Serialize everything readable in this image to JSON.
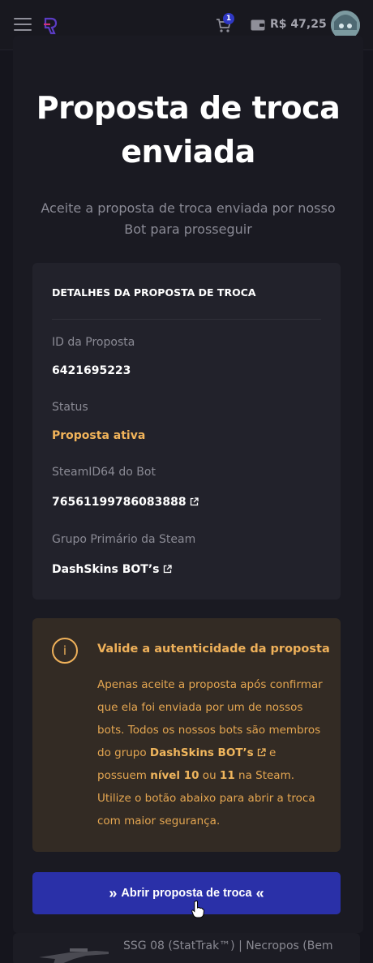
{
  "header": {
    "cart_count": "1",
    "balance": "R$ 47,25",
    "icons": {
      "menu": "hamburger-icon",
      "logo": "dashskins-logo",
      "cart": "cart-icon",
      "wallet": "wallet-icon"
    }
  },
  "modal": {
    "title": "Proposta de troca enviada",
    "subtitle": "Aceite a proposta de troca enviada por nosso Bot para prosseguir",
    "details": {
      "heading": "DETALHES DA PROPOSTA DE TROCA",
      "fields": [
        {
          "label": "ID da Proposta",
          "value": "6421695223"
        },
        {
          "label": "Status",
          "value": "Proposta ativa"
        },
        {
          "label": "SteamID64 do Bot",
          "value": "76561199786083888"
        },
        {
          "label": "Grupo Primário da Steam",
          "value": "DashSkins BOT’s"
        }
      ]
    },
    "warning": {
      "icon_text": "i",
      "title": "Valide a autenticidade da proposta",
      "body_1": "Apenas aceite a proposta após confirmar que ela foi enviada por um de nossos bots. Todos os nossos bots são membros do grupo ",
      "group_link": "DashSkins BOT’s",
      "body_2": " e possuem ",
      "level_a": "nível 10",
      "body_3": " ou ",
      "level_b": "11",
      "body_4": " na Steam. Utilize o botão abaixo para abrir a troca com maior segurança."
    },
    "button": {
      "chev_left": "»",
      "label": "Abrir proposta de troca",
      "chev_right": "«"
    }
  },
  "background_item": {
    "name": "SSG 08 (StatTrak™) | Necropos (Bem"
  },
  "colors": {
    "accent_blue": "#2a30a8",
    "warning_text": "#efb15a",
    "status_active": "#f2b45a",
    "panel": "#22222b"
  }
}
